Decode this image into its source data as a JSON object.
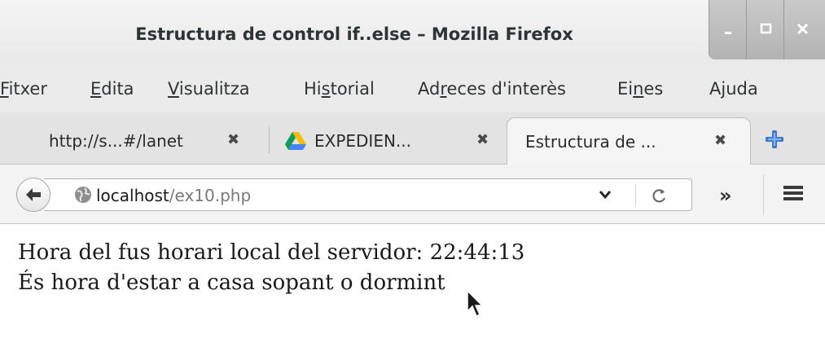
{
  "window": {
    "title": "Estructura de control if..else – Mozilla Firefox"
  },
  "menu": {
    "items": [
      {
        "first": "F",
        "rest": "itxer"
      },
      {
        "first": "E",
        "rest": "dita"
      },
      {
        "first": "V",
        "rest": "isualitza"
      },
      {
        "pre": "Hi",
        "u": "s",
        "post": "torial"
      },
      {
        "pre": "Ad",
        "u": "r",
        "post": "eces d'interès"
      },
      {
        "pre": "Ei",
        "u": "n",
        "post": "es"
      },
      {
        "pre": "A",
        "u": "j",
        "post": "uda"
      }
    ]
  },
  "tabs": [
    {
      "label": "http://s...#/lanet",
      "close": "✖"
    },
    {
      "label": "EXPEDIEN...",
      "close": "✖"
    },
    {
      "label": "Estructura de ...",
      "close": "✖"
    }
  ],
  "nav": {
    "url_host": "localhost",
    "url_path": "/ex10.php",
    "dropdown": "⌄",
    "overflow": "»"
  },
  "icons": {
    "back": "arrow-left-icon",
    "site": "globe-icon",
    "reload": "reload-icon",
    "menu": "hamburger-icon",
    "newtab": "plus-icon",
    "drive": "google-drive-icon"
  },
  "content": {
    "line1": "Hora del fus horari local del servidor: 22:44:13",
    "line2": "És hora d'estar a casa sopant o dormint"
  }
}
